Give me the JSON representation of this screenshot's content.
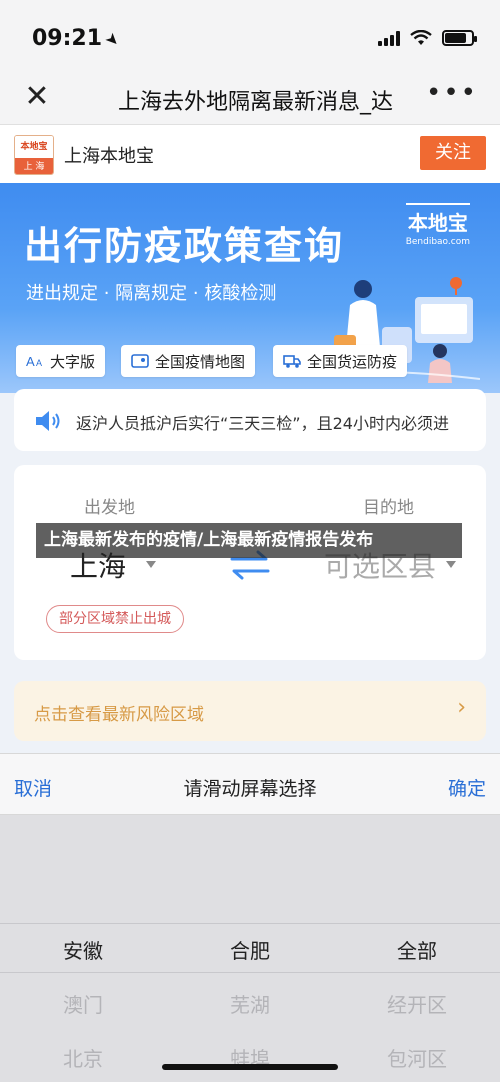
{
  "status_bar": {
    "time": "09:21"
  },
  "nav": {
    "close_icon": "close-icon",
    "title": "上海去外地隔离最新消息_达",
    "more_icon": "more-icon"
  },
  "account": {
    "logo_top": "本地宝",
    "logo_bottom": "上 海",
    "name": "上海本地宝",
    "follow_label": "关注"
  },
  "banner": {
    "title": "出行防疫政策查询",
    "subtitle": "进出规定 · 隔离规定 · 核酸检测",
    "logo_main": "本地宝",
    "logo_url": "Bendibao.com"
  },
  "quick_buttons": [
    {
      "label": "大字版",
      "icon": "font-size-icon"
    },
    {
      "label": "全国疫情地图",
      "icon": "map-icon"
    },
    {
      "label": "全国货运防疫",
      "icon": "truck-icon"
    }
  ],
  "notice": {
    "icon": "speaker-icon",
    "text": "返沪人员抵沪后实行“三天三检”，且24小时内必须进"
  },
  "route": {
    "from_label": "出发地",
    "to_label": "目的地",
    "from_city": "上海",
    "to_placeholder": "可选区县",
    "restrict_badge": "部分区域禁止出城"
  },
  "overlay": {
    "text": "上海最新发布的疫情/上海最新疫情报告发布"
  },
  "risk": {
    "text": "点击查看最新风险区域"
  },
  "picker": {
    "cancel": "取消",
    "hint": "请滑动屏幕选择",
    "confirm": "确定",
    "columns": [
      {
        "selected": "安徽",
        "below": [
          "澳门",
          "北京"
        ]
      },
      {
        "selected": "合肥",
        "below": [
          "芜湖",
          "蚌埠"
        ]
      },
      {
        "selected": "全部",
        "below": [
          "经开区",
          "包河区"
        ]
      }
    ]
  },
  "colors": {
    "accent_orange": "#f06a32",
    "link_blue": "#2a6fd6",
    "banner_blue": "#3f8cf0",
    "risk_text": "#d79a46"
  }
}
